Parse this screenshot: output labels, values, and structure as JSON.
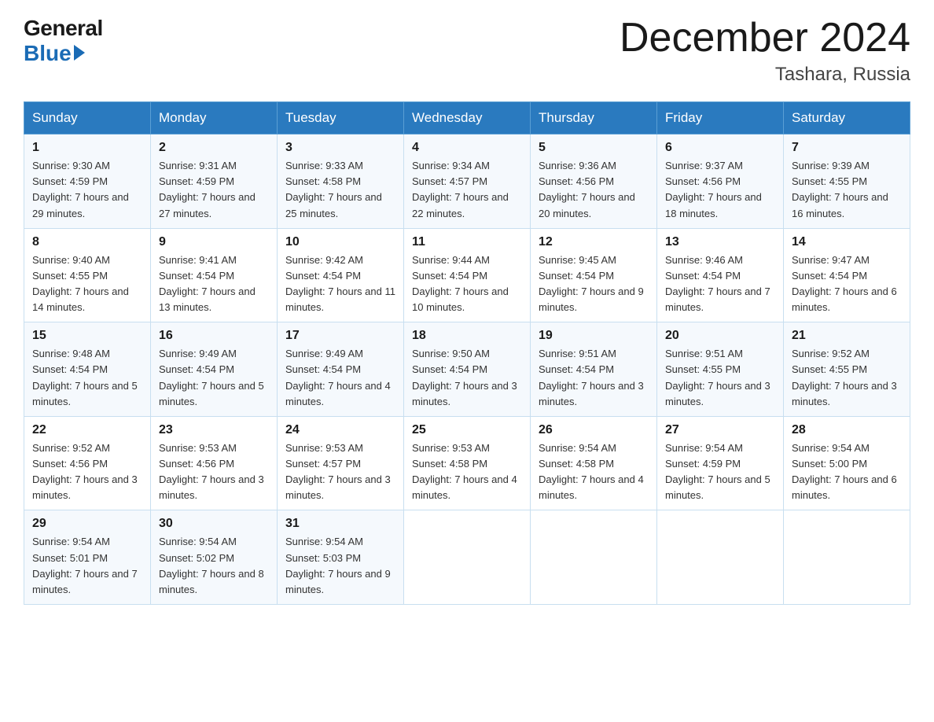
{
  "header": {
    "logo_general": "General",
    "logo_blue": "Blue",
    "month_title": "December 2024",
    "location": "Tashara, Russia"
  },
  "days_of_week": [
    "Sunday",
    "Monday",
    "Tuesday",
    "Wednesday",
    "Thursday",
    "Friday",
    "Saturday"
  ],
  "weeks": [
    [
      {
        "day": "1",
        "sunrise": "9:30 AM",
        "sunset": "4:59 PM",
        "daylight": "7 hours and 29 minutes."
      },
      {
        "day": "2",
        "sunrise": "9:31 AM",
        "sunset": "4:59 PM",
        "daylight": "7 hours and 27 minutes."
      },
      {
        "day": "3",
        "sunrise": "9:33 AM",
        "sunset": "4:58 PM",
        "daylight": "7 hours and 25 minutes."
      },
      {
        "day": "4",
        "sunrise": "9:34 AM",
        "sunset": "4:57 PM",
        "daylight": "7 hours and 22 minutes."
      },
      {
        "day": "5",
        "sunrise": "9:36 AM",
        "sunset": "4:56 PM",
        "daylight": "7 hours and 20 minutes."
      },
      {
        "day": "6",
        "sunrise": "9:37 AM",
        "sunset": "4:56 PM",
        "daylight": "7 hours and 18 minutes."
      },
      {
        "day": "7",
        "sunrise": "9:39 AM",
        "sunset": "4:55 PM",
        "daylight": "7 hours and 16 minutes."
      }
    ],
    [
      {
        "day": "8",
        "sunrise": "9:40 AM",
        "sunset": "4:55 PM",
        "daylight": "7 hours and 14 minutes."
      },
      {
        "day": "9",
        "sunrise": "9:41 AM",
        "sunset": "4:54 PM",
        "daylight": "7 hours and 13 minutes."
      },
      {
        "day": "10",
        "sunrise": "9:42 AM",
        "sunset": "4:54 PM",
        "daylight": "7 hours and 11 minutes."
      },
      {
        "day": "11",
        "sunrise": "9:44 AM",
        "sunset": "4:54 PM",
        "daylight": "7 hours and 10 minutes."
      },
      {
        "day": "12",
        "sunrise": "9:45 AM",
        "sunset": "4:54 PM",
        "daylight": "7 hours and 9 minutes."
      },
      {
        "day": "13",
        "sunrise": "9:46 AM",
        "sunset": "4:54 PM",
        "daylight": "7 hours and 7 minutes."
      },
      {
        "day": "14",
        "sunrise": "9:47 AM",
        "sunset": "4:54 PM",
        "daylight": "7 hours and 6 minutes."
      }
    ],
    [
      {
        "day": "15",
        "sunrise": "9:48 AM",
        "sunset": "4:54 PM",
        "daylight": "7 hours and 5 minutes."
      },
      {
        "day": "16",
        "sunrise": "9:49 AM",
        "sunset": "4:54 PM",
        "daylight": "7 hours and 5 minutes."
      },
      {
        "day": "17",
        "sunrise": "9:49 AM",
        "sunset": "4:54 PM",
        "daylight": "7 hours and 4 minutes."
      },
      {
        "day": "18",
        "sunrise": "9:50 AM",
        "sunset": "4:54 PM",
        "daylight": "7 hours and 3 minutes."
      },
      {
        "day": "19",
        "sunrise": "9:51 AM",
        "sunset": "4:54 PM",
        "daylight": "7 hours and 3 minutes."
      },
      {
        "day": "20",
        "sunrise": "9:51 AM",
        "sunset": "4:55 PM",
        "daylight": "7 hours and 3 minutes."
      },
      {
        "day": "21",
        "sunrise": "9:52 AM",
        "sunset": "4:55 PM",
        "daylight": "7 hours and 3 minutes."
      }
    ],
    [
      {
        "day": "22",
        "sunrise": "9:52 AM",
        "sunset": "4:56 PM",
        "daylight": "7 hours and 3 minutes."
      },
      {
        "day": "23",
        "sunrise": "9:53 AM",
        "sunset": "4:56 PM",
        "daylight": "7 hours and 3 minutes."
      },
      {
        "day": "24",
        "sunrise": "9:53 AM",
        "sunset": "4:57 PM",
        "daylight": "7 hours and 3 minutes."
      },
      {
        "day": "25",
        "sunrise": "9:53 AM",
        "sunset": "4:58 PM",
        "daylight": "7 hours and 4 minutes."
      },
      {
        "day": "26",
        "sunrise": "9:54 AM",
        "sunset": "4:58 PM",
        "daylight": "7 hours and 4 minutes."
      },
      {
        "day": "27",
        "sunrise": "9:54 AM",
        "sunset": "4:59 PM",
        "daylight": "7 hours and 5 minutes."
      },
      {
        "day": "28",
        "sunrise": "9:54 AM",
        "sunset": "5:00 PM",
        "daylight": "7 hours and 6 minutes."
      }
    ],
    [
      {
        "day": "29",
        "sunrise": "9:54 AM",
        "sunset": "5:01 PM",
        "daylight": "7 hours and 7 minutes."
      },
      {
        "day": "30",
        "sunrise": "9:54 AM",
        "sunset": "5:02 PM",
        "daylight": "7 hours and 8 minutes."
      },
      {
        "day": "31",
        "sunrise": "9:54 AM",
        "sunset": "5:03 PM",
        "daylight": "7 hours and 9 minutes."
      },
      null,
      null,
      null,
      null
    ]
  ],
  "labels": {
    "sunrise": "Sunrise:",
    "sunset": "Sunset:",
    "daylight": "Daylight:"
  }
}
